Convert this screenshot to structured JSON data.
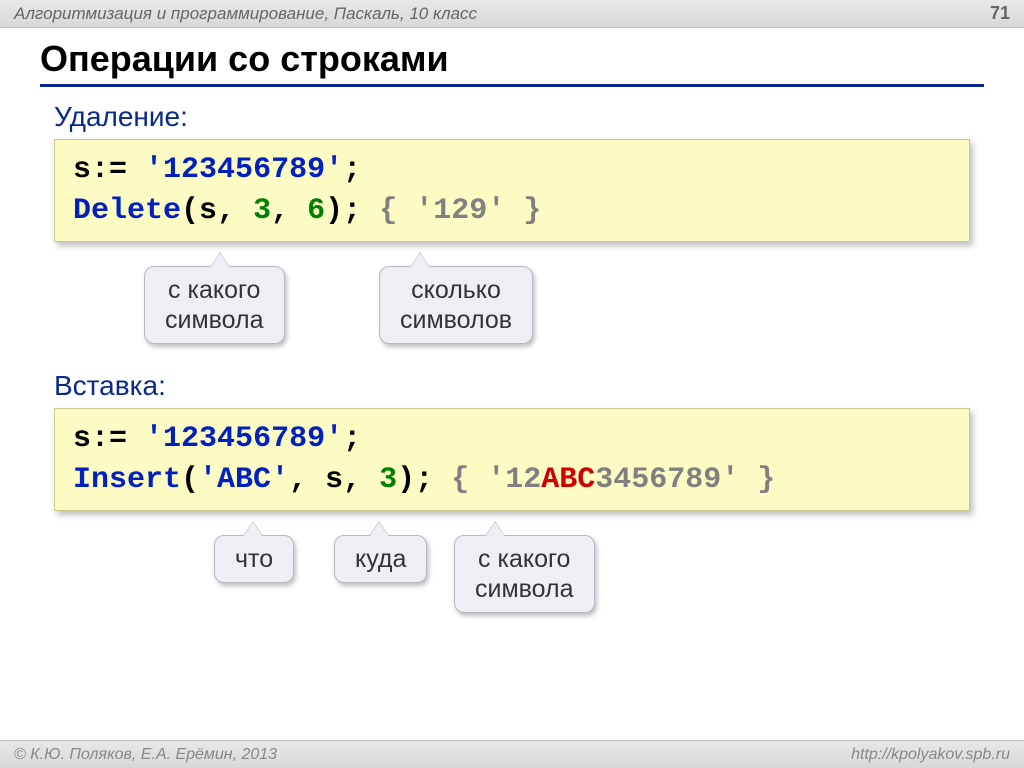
{
  "header": {
    "breadcrumb": "Алгоритмизация и программирование, Паскаль, 10 класс",
    "page_number": "71"
  },
  "title": "Операции со строками",
  "delete_section": {
    "label": "Удаление:",
    "code": {
      "line1": {
        "var": "s",
        "assign": ":=",
        "str": "'123456789'",
        "semi": ";"
      },
      "line2": {
        "func": "Delete",
        "open": "(",
        "arg1": "s",
        "comma1": ",",
        "arg2": "3",
        "comma2": ",",
        "arg3": "6",
        "close": ");",
        "comment_open": "{",
        "comment_body": "'129'",
        "comment_close": "}"
      }
    },
    "callouts": {
      "from_char": "с какого\nсимвола",
      "how_many": "сколько\nсимволов"
    }
  },
  "insert_section": {
    "label": "Вставка:",
    "code": {
      "line1": {
        "var": "s",
        "assign": ":=",
        "str": "'123456789'",
        "semi": ";"
      },
      "line2": {
        "func": "Insert",
        "open": "(",
        "arg1": "'ABC'",
        "comma1": ",",
        "arg2": "s",
        "comma2": ",",
        "arg3": "3",
        "close": ");",
        "comment_open": "{",
        "comment_pre": "'12",
        "comment_hl": "ABC",
        "comment_post": "3456789'",
        "comment_close": "}"
      }
    },
    "callouts": {
      "what": "что",
      "where": "куда",
      "from_char": "с какого\nсимвола"
    }
  },
  "footer": {
    "copyright": "© К.Ю. Поляков, Е.А. Ерёмин, 2013",
    "url": "http://kpolyakov.spb.ru"
  }
}
